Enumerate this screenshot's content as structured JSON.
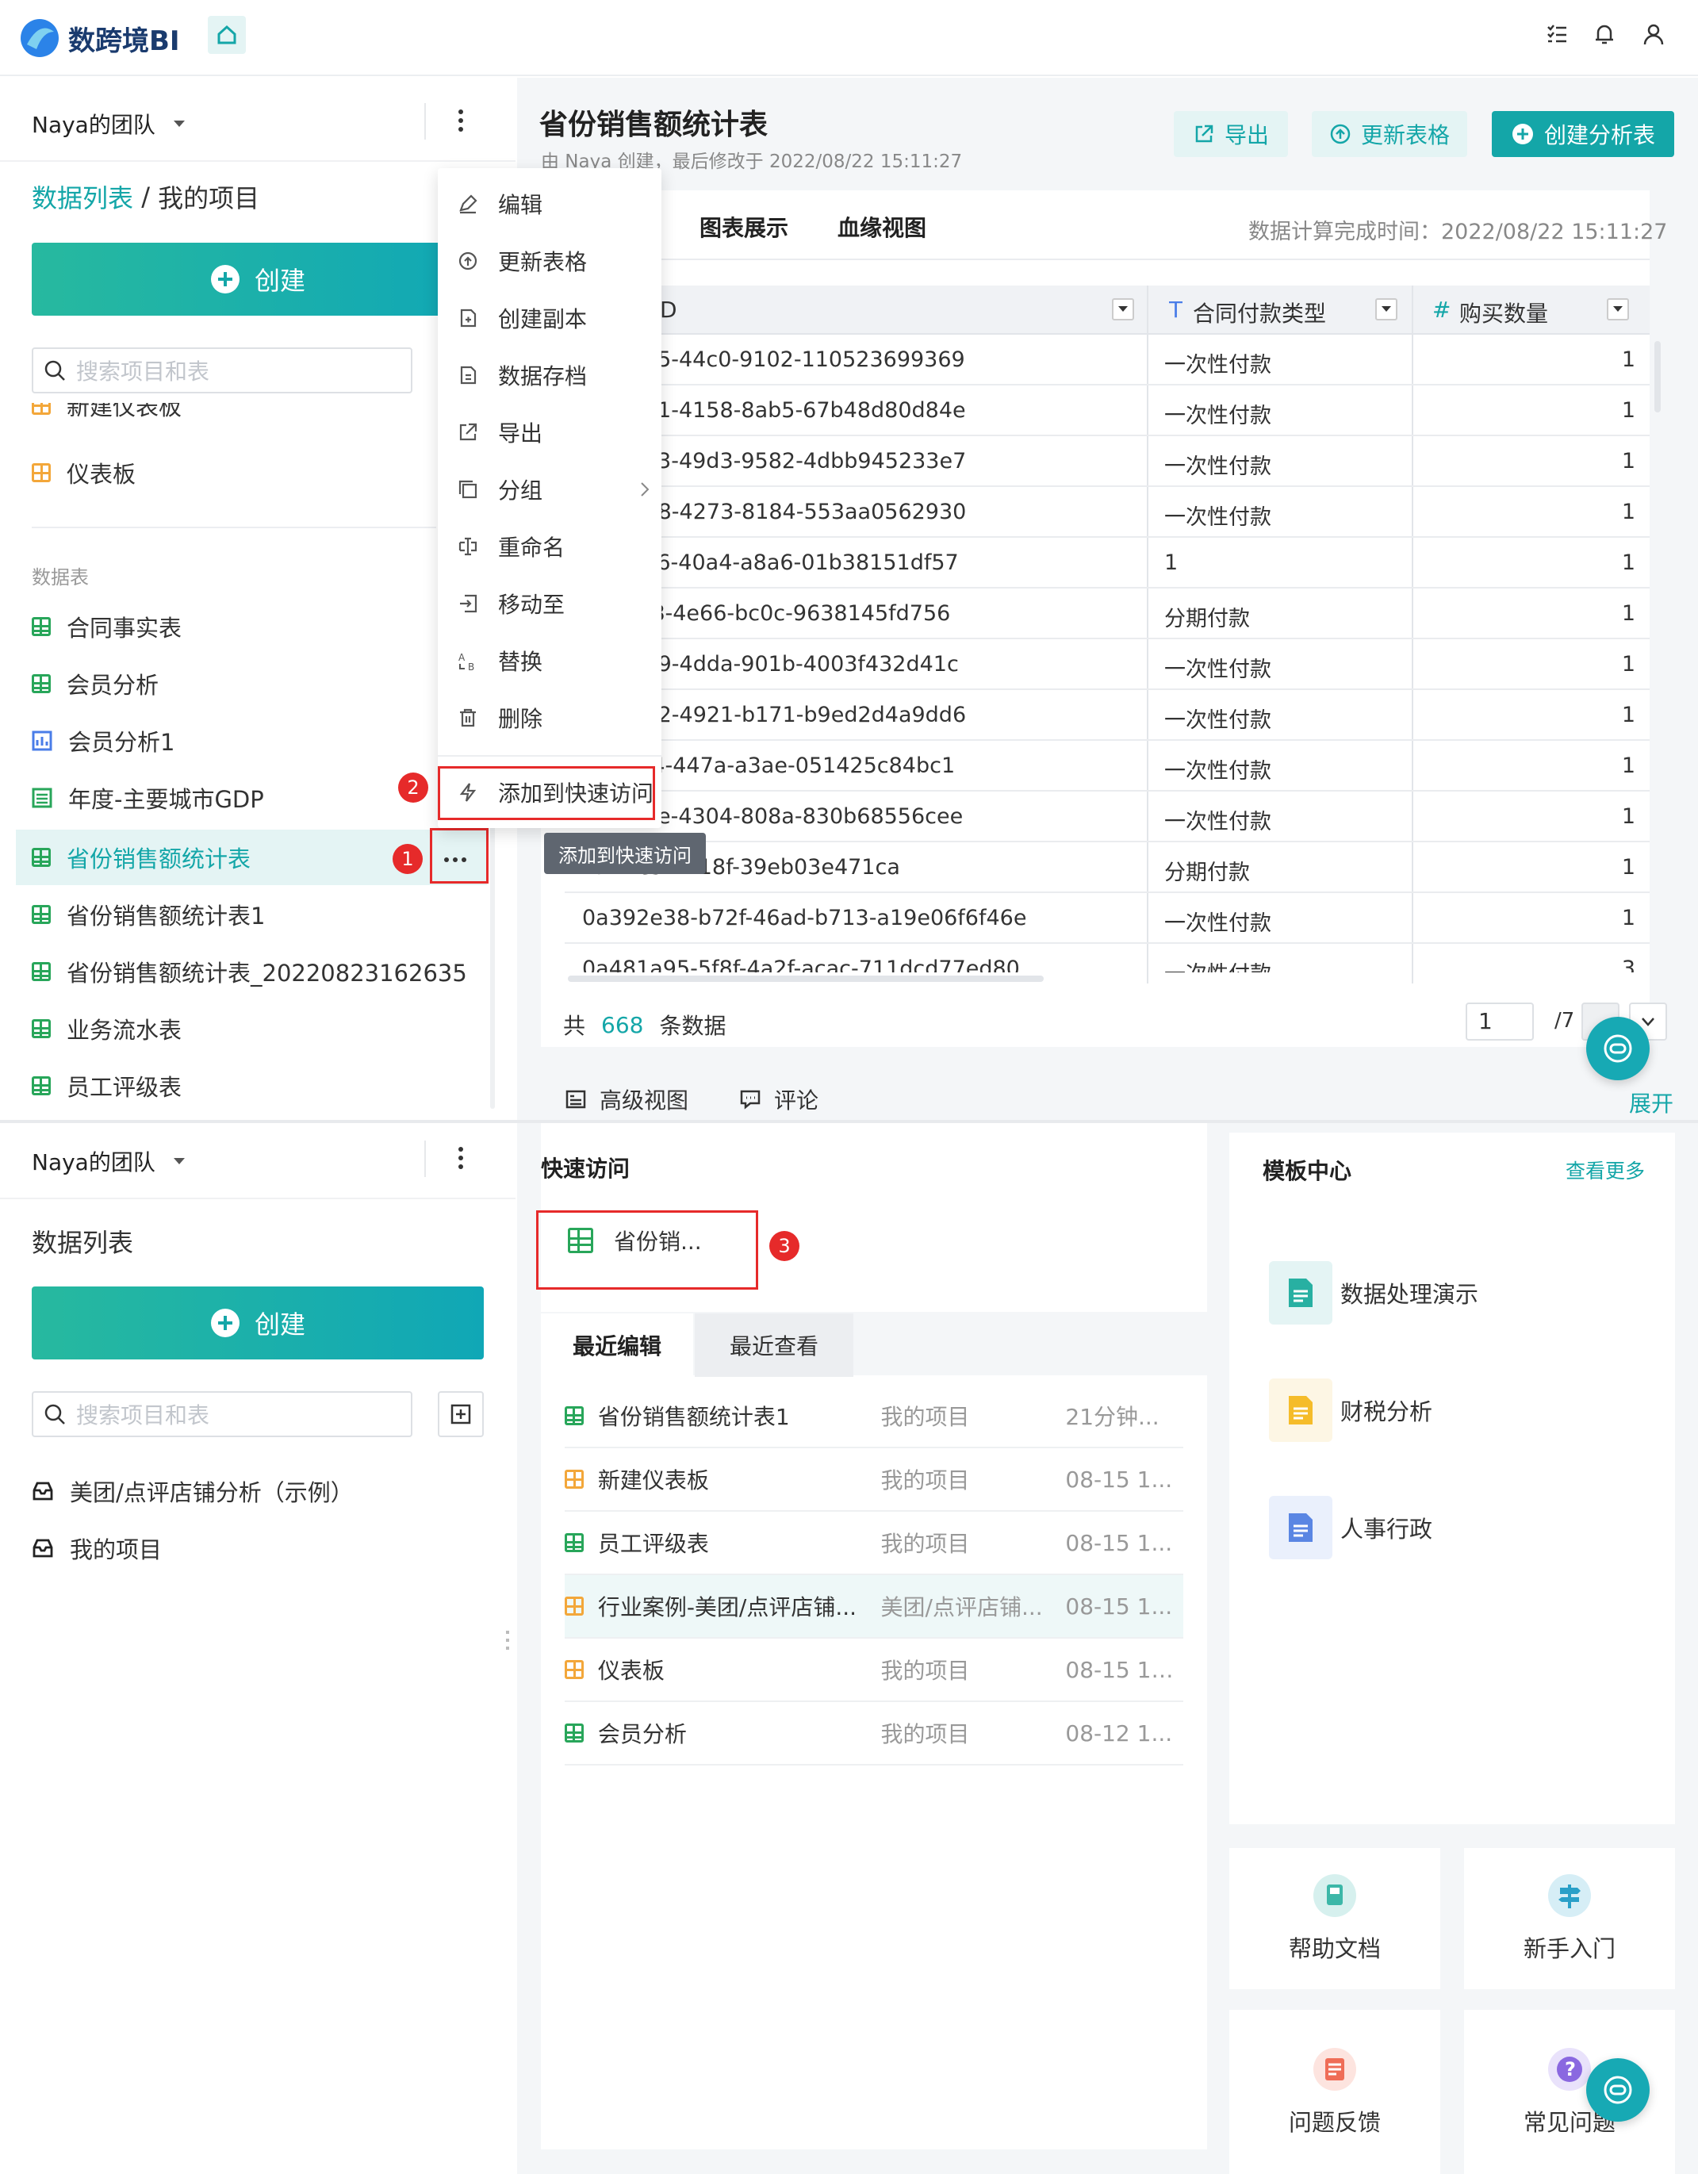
{
  "app": {
    "name": "数跨境BI"
  },
  "header": {
    "icons": [
      "home-icon",
      "task-list-icon",
      "bell-icon",
      "user-icon"
    ]
  },
  "top_panel": {
    "sidebar": {
      "team": "Naya的团队",
      "breadcrumb_link": "数据列表",
      "breadcrumb_sep": " / ",
      "breadcrumb_current": "我的项目",
      "create_label": "创建",
      "search_placeholder": "搜索项目和表",
      "partial_item": "新建仪表板",
      "dashboard_item": "仪表板",
      "section_label": "数据表",
      "tables": [
        "合同事实表",
        "会员分析",
        "会员分析1",
        "年度-主要城市GDP",
        "省份销售额统计表",
        "省份销售额统计表1",
        "省份销售额统计表_20220823162635",
        "业务流水表",
        "员工评级表"
      ]
    },
    "context_menu": {
      "items": [
        "编辑",
        "更新表格",
        "创建副本",
        "数据存档",
        "导出",
        "分组",
        "重命名",
        "移动至",
        "替换",
        "删除"
      ],
      "quick_access": "添加到快速访问",
      "tooltip": "添加到快速访问"
    },
    "annotations": {
      "step1": "1",
      "step2": "2",
      "step3": "3"
    },
    "main": {
      "title": "省份销售额统计表",
      "subtitle": "由 Naya 创建，最后修改于 2022/08/22 15:11:27",
      "export_label": "导出",
      "refresh_label": "更新表格",
      "create_analysis_label": "创建分析表",
      "tabs": [
        "图表展示",
        "血缘视图"
      ],
      "compute_time": "数据计算完成时间：2022/08/22 15:11:27",
      "columns": [
        "D",
        "合同付款类型",
        "购买数量"
      ],
      "column_type_marks": [
        "T",
        "#"
      ],
      "rows": [
        [
          "27-e145-44c0-9102-110523699369",
          "一次性付款",
          "1"
        ],
        [
          "0e-59d1-4158-8ab5-67b48d80d84e",
          "一次性付款",
          "1"
        ],
        [
          "b3-08e3-49d3-9582-4dbb945233e7",
          "一次性付款",
          "1"
        ],
        [
          "02-5828-4273-8184-553aa0562930",
          "一次性付款",
          "1"
        ],
        [
          "a7-a186-40a4-a8a6-01b38151df57",
          "1",
          "1"
        ],
        [
          "2a-27f8-4e66-bc0c-9638145fd756",
          "分期付款",
          "1"
        ],
        [
          "64-8159-4dda-901b-4003f432d41c",
          "一次性付款",
          "1"
        ],
        [
          "1d-7372-4921-b171-b9ed2d4a9dd6",
          "一次性付款",
          "1"
        ],
        [
          "68-af54-447a-a3ae-051425c84bc1",
          "一次性付款",
          "1"
        ],
        [
          "2a-7b5e-4304-808a-830b68556cee",
          "一次性付款",
          "1"
        ],
        [
          "bfd-4c9b-b18f-39eb03e471ca",
          "分期付款",
          "1"
        ],
        [
          "0a392e38-b72f-46ad-b713-a19e06f6f46e",
          "一次性付款",
          "1"
        ],
        [
          "0a481a95-5f8f-4a2f-acac-711dcd77ed80",
          "一次性付款",
          "3"
        ]
      ],
      "total_prefix": "共",
      "total_count": "668",
      "total_suffix": "条数据",
      "page_current": "1",
      "page_total": "/7",
      "bottom_tabs": [
        "高级视图",
        "评论"
      ],
      "expand_label": "展开"
    }
  },
  "bottom_panel": {
    "sidebar": {
      "team": "Naya的团队",
      "title": "数据列表",
      "create_label": "创建",
      "search_placeholder": "搜索项目和表",
      "projects": [
        "美团/点评店铺分析（示例）",
        "我的项目"
      ]
    },
    "quick_access": {
      "title": "快速访问",
      "item": "省份销..."
    },
    "recent": {
      "tabs": [
        "最近编辑",
        "最近查看"
      ],
      "rows": [
        {
          "name": "省份销售额统计表1",
          "project": "我的项目",
          "time": "21分钟...",
          "kind": "table"
        },
        {
          "name": "新建仪表板",
          "project": "我的项目",
          "time": "08-15 1...",
          "kind": "dashboard"
        },
        {
          "name": "员工评级表",
          "project": "我的项目",
          "time": "08-15 1...",
          "kind": "table"
        },
        {
          "name": "行业案例-美团/点评店铺...",
          "project": "美团/点评店铺...",
          "time": "08-15 1...",
          "kind": "dashboard"
        },
        {
          "name": "仪表板",
          "project": "我的项目",
          "time": "08-15 11...",
          "kind": "dashboard"
        },
        {
          "name": "会员分析",
          "project": "我的项目",
          "time": "08-12 1...",
          "kind": "table"
        }
      ]
    },
    "template_center": {
      "title": "模板中心",
      "more": "查看更多",
      "items": [
        "数据处理演示",
        "财税分析",
        "人事行政"
      ]
    },
    "help": {
      "items": [
        "帮助文档",
        "新手入门",
        "问题反馈",
        "常见问题"
      ]
    }
  },
  "colors": {
    "accent": "#14a6a8",
    "annotation": "#e62a2a",
    "table_icon": "#28a65a",
    "dashboard_icon": "#f3a73a"
  }
}
